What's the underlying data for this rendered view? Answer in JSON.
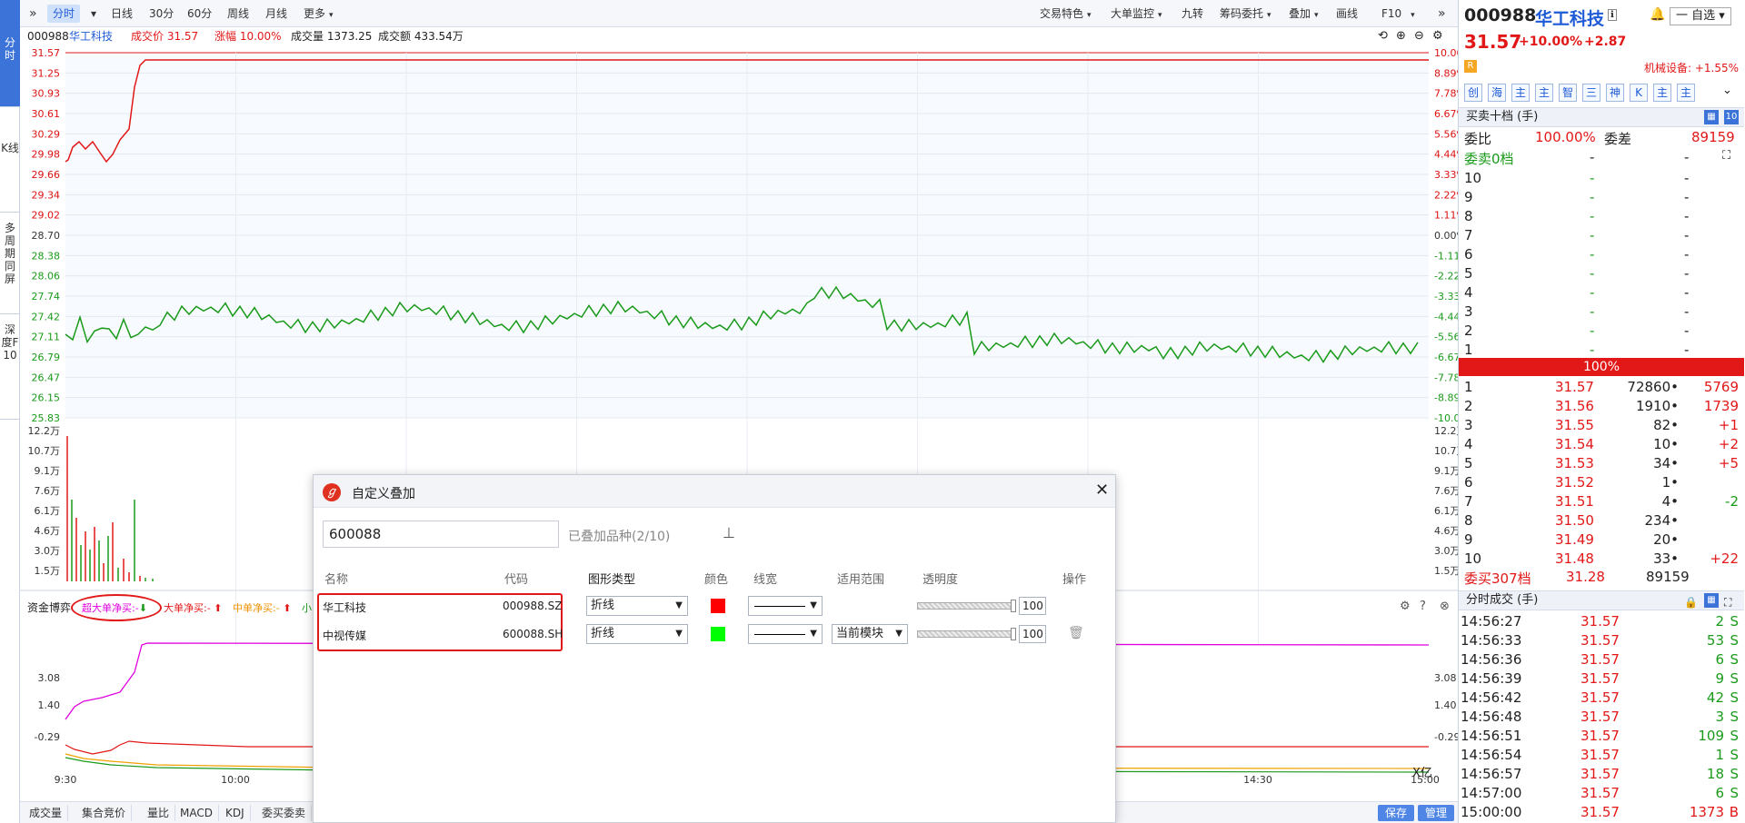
{
  "left_tabs": [
    "分时",
    "K线",
    "多周期同屏",
    "深度F10"
  ],
  "toolbar": {
    "expand_icon": "double-chevron-right-icon",
    "left": [
      "分时",
      "日线",
      "30分",
      "60分",
      "周线",
      "月线",
      "更多"
    ],
    "right": [
      "交易特色",
      "大单监控",
      "九转",
      "筹码委托",
      "叠加",
      "画线",
      "F10"
    ]
  },
  "info_line": {
    "code": "000988",
    "name": "华工科技",
    "price_label": "成交价 31.57",
    "change_label": "涨幅 10.00%",
    "volume_label": "成交量 1373.25",
    "amount_label": "成交额 433.54万"
  },
  "price_axis_left": [
    "31.57",
    "31.25",
    "30.93",
    "30.61",
    "30.29",
    "29.98",
    "29.66",
    "29.34",
    "29.02",
    "28.70",
    "28.38",
    "28.06",
    "27.74",
    "27.42",
    "27.11",
    "26.79",
    "26.47",
    "26.15",
    "25.83"
  ],
  "price_axis_right": [
    "10.00%",
    "8.89%",
    "7.78%",
    "6.67%",
    "5.56%",
    "4.44%",
    "3.33%",
    "2.22%",
    "1.11%",
    "0.00%",
    "-1.11%",
    "-2.22%",
    "-3.33%",
    "-4.44%",
    "-5.56%",
    "-6.67%",
    "-7.78%",
    "-8.89%",
    "-10.00%"
  ],
  "volume_axis": [
    "12.2万",
    "10.7万",
    "9.1万",
    "7.6万",
    "6.1万",
    "4.6万",
    "3.0万",
    "1.5万"
  ],
  "fund_panel": {
    "title": "资金博弈",
    "super_large": "超大单净买:-",
    "large": "大单净买:-",
    "medium": "中单净买:-",
    "small": "小",
    "axis": [
      "3.08",
      "1.40",
      "-0.29"
    ],
    "unit": "X亿"
  },
  "time_axis": [
    "9:30",
    "10:00",
    "14:30",
    "15:00"
  ],
  "bottom_tabs": [
    "成交量",
    "集合竞价",
    "量比",
    "MACD",
    "KDJ",
    "委买委卖"
  ],
  "bottom_right": {
    "save": "保存",
    "manage": "管理"
  },
  "dialog": {
    "title": "自定义叠加",
    "search_value": "600088",
    "count_label": "已叠加品种(2/10)",
    "columns": [
      "名称",
      "代码",
      "图形类型",
      "颜色",
      "线宽",
      "适用范围",
      "透明度",
      "操作"
    ],
    "rows": [
      {
        "name": "华工科技",
        "code": "000988.SZ",
        "type": "折线",
        "color": "#ff0000",
        "scope": "",
        "opacity": "100"
      },
      {
        "name": "中视传媒",
        "code": "600088.SH",
        "type": "折线",
        "color": "#00ff00",
        "scope": "当前模块",
        "opacity": "100"
      }
    ]
  },
  "right_panel": {
    "code": "000988",
    "name": "华工科技",
    "watch_btn": "一 自选",
    "price": "31.57",
    "pct": "+10.00%",
    "chg": "+2.87",
    "r_badge": "R",
    "sector": "机械设备: +1.55%",
    "quick_buttons": [
      "创",
      "海",
      "主",
      "主",
      "智",
      "三",
      "神",
      "K",
      "主",
      "主"
    ],
    "order_book_title": "买卖十档 (手)",
    "order_book_count": "10",
    "weibi_label": "委比",
    "weibi": "100.00%",
    "weicha_label": "委差",
    "weicha": "89159",
    "sell_total": "委卖0档",
    "sells": [
      {
        "lvl": "10",
        "p": "-",
        "v": "-"
      },
      {
        "lvl": "9",
        "p": "-",
        "v": "-"
      },
      {
        "lvl": "8",
        "p": "-",
        "v": "-"
      },
      {
        "lvl": "7",
        "p": "-",
        "v": "-"
      },
      {
        "lvl": "6",
        "p": "-",
        "v": "-"
      },
      {
        "lvl": "5",
        "p": "-",
        "v": "-"
      },
      {
        "lvl": "4",
        "p": "-",
        "v": "-"
      },
      {
        "lvl": "3",
        "p": "-",
        "v": "-"
      },
      {
        "lvl": "2",
        "p": "-",
        "v": "-"
      },
      {
        "lvl": "1",
        "p": "-",
        "v": "-"
      }
    ],
    "ratio_bar": "100%",
    "buys": [
      {
        "lvl": "1",
        "p": "31.57",
        "v": "72860",
        "d": "5769"
      },
      {
        "lvl": "2",
        "p": "31.56",
        "v": "1910",
        "d": "1739"
      },
      {
        "lvl": "3",
        "p": "31.55",
        "v": "82",
        "d": "+1"
      },
      {
        "lvl": "4",
        "p": "31.54",
        "v": "10",
        "d": "+2"
      },
      {
        "lvl": "5",
        "p": "31.53",
        "v": "34",
        "d": "+5"
      },
      {
        "lvl": "6",
        "p": "31.52",
        "v": "1",
        "d": ""
      },
      {
        "lvl": "7",
        "p": "31.51",
        "v": "4",
        "d": "-2"
      },
      {
        "lvl": "8",
        "p": "31.50",
        "v": "234",
        "d": ""
      },
      {
        "lvl": "9",
        "p": "31.49",
        "v": "20",
        "d": ""
      },
      {
        "lvl": "10",
        "p": "31.48",
        "v": "33",
        "d": "+22"
      }
    ],
    "buy_total_label": "委买307档",
    "buy_total_price": "31.28",
    "buy_total_vol": "89159",
    "trades_title": "分时成交 (手)",
    "trades": [
      {
        "t": "14:56:27",
        "p": "31.57",
        "v": "2",
        "s": "S"
      },
      {
        "t": "14:56:33",
        "p": "31.57",
        "v": "53",
        "s": "S"
      },
      {
        "t": "14:56:36",
        "p": "31.57",
        "v": "6",
        "s": "S"
      },
      {
        "t": "14:56:39",
        "p": "31.57",
        "v": "9",
        "s": "S"
      },
      {
        "t": "14:56:42",
        "p": "31.57",
        "v": "42",
        "s": "S"
      },
      {
        "t": "14:56:48",
        "p": "31.57",
        "v": "3",
        "s": "S"
      },
      {
        "t": "14:56:51",
        "p": "31.57",
        "v": "109",
        "s": "S"
      },
      {
        "t": "14:56:54",
        "p": "31.57",
        "v": "1",
        "s": "S"
      },
      {
        "t": "14:56:57",
        "p": "31.57",
        "v": "18",
        "s": "S"
      },
      {
        "t": "14:57:00",
        "p": "31.57",
        "v": "6",
        "s": "S"
      },
      {
        "t": "15:00:00",
        "p": "31.57",
        "v": "1373",
        "s": "B"
      }
    ]
  },
  "colors": {
    "up": "#e21818",
    "down": "#1a9a1a",
    "accent": "#1e5bd6",
    "fund_super": "#e000e0"
  }
}
